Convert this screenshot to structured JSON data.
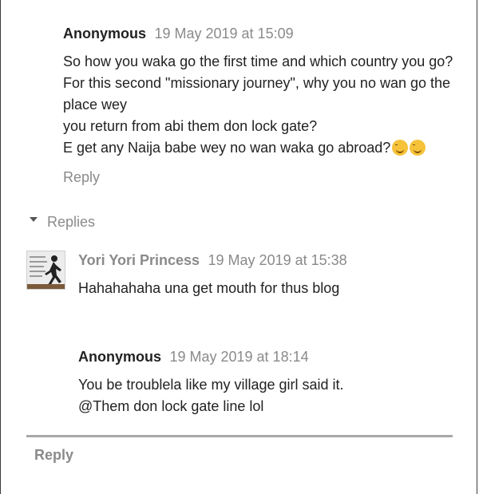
{
  "comments": [
    {
      "author": "Anonymous",
      "timestamp": "19 May 2019 at 15:09",
      "lines": [
        "So how you waka go the first time and which country you go?",
        "For this second \"missionary journey\", why you no wan go the place wey",
        "you return from abi them don lock gate?",
        "E get any Naija babe wey no wan waka go abroad?"
      ],
      "emoji": "smiling-face-icon",
      "reply_label": "Reply"
    }
  ],
  "replies_toggle": "Replies",
  "replies": [
    {
      "author": "Yori Yori Princess",
      "timestamp": "19 May 2019 at 15:38",
      "avatar": "runner-silhouette-avatar",
      "lines": [
        "Hahahahaha una get mouth for thus blog"
      ]
    },
    {
      "author": "Anonymous",
      "timestamp": "19 May 2019 at 18:14",
      "lines": [
        "You be troublela like my village girl said it.",
        "@Them don lock gate line lol"
      ]
    }
  ],
  "bottom_reply": "Reply",
  "colors": {
    "meta": "#8a8a8a",
    "text": "#222222",
    "divider": "#a9a9a9"
  }
}
